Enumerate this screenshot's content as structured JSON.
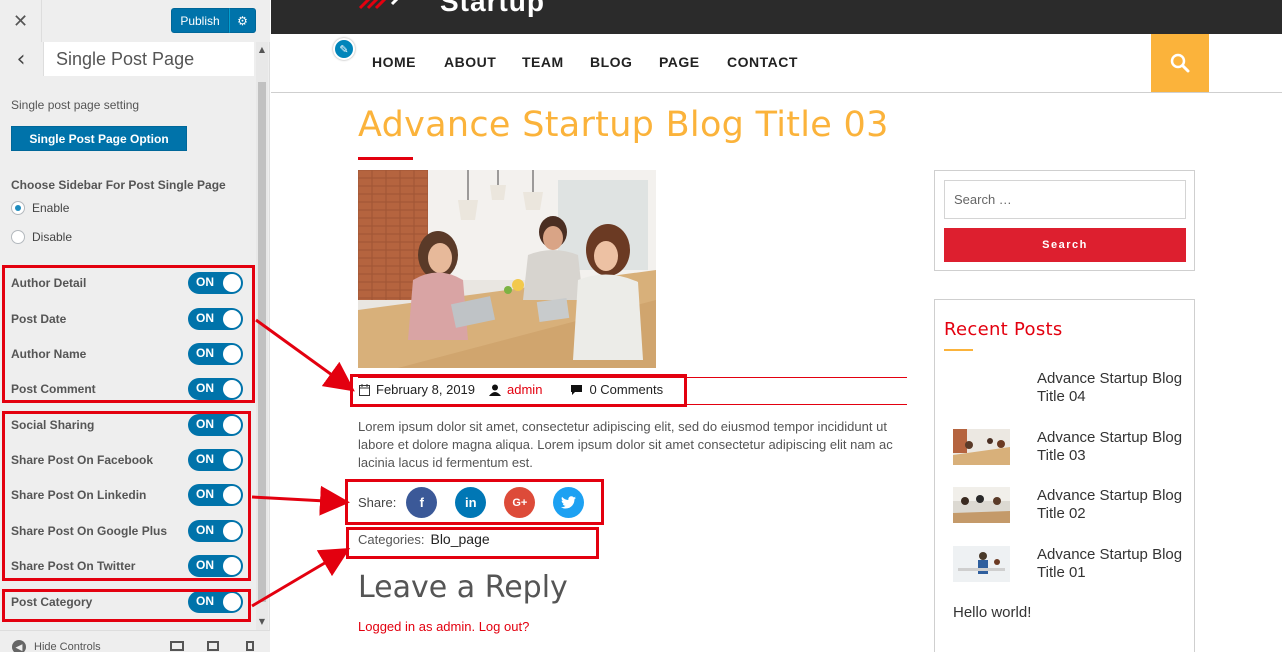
{
  "customizer": {
    "close_icon": "close-icon",
    "publish_label": "Publish",
    "section_title": "Single Post Page",
    "setting_caption": "Single post page setting",
    "option_button_label": "Single Post Page Option",
    "sidebar_group_label": "Choose Sidebar For Post Single Page",
    "radio_options": [
      {
        "label": "Enable",
        "checked": true
      },
      {
        "label": "Disable",
        "checked": false
      }
    ],
    "toggles": [
      {
        "label": "Author Detail",
        "state": "ON"
      },
      {
        "label": "Post Date",
        "state": "ON"
      },
      {
        "label": "Author Name",
        "state": "ON"
      },
      {
        "label": "Post Comment",
        "state": "ON"
      },
      {
        "label": "Social Sharing",
        "state": "ON"
      },
      {
        "label": "Share Post On Facebook",
        "state": "ON"
      },
      {
        "label": "Share Post On Linkedin",
        "state": "ON"
      },
      {
        "label": "Share Post On Google Plus",
        "state": "ON"
      },
      {
        "label": "Share Post On Twitter",
        "state": "ON"
      },
      {
        "label": "Post Category",
        "state": "ON"
      }
    ],
    "hide_controls_label": "Hide Controls",
    "accent_color": "#0073aa",
    "highlight_color": "#e3000f"
  },
  "site": {
    "logo_text": "Startup",
    "nav": [
      "HOME",
      "ABOUT",
      "TEAM",
      "BLOG",
      "PAGE",
      "CONTACT"
    ],
    "accent_color": "#fbb33b",
    "post": {
      "title": "Advance Startup Blog Title 03",
      "date": "February 8, 2019",
      "author": "admin",
      "comments": "0 Comments",
      "excerpt": "Lorem ipsum dolor sit amet, consectetur adipiscing elit, sed do eiusmod tempor incididunt ut labore et dolore magna aliqua. Lorem ipsum dolor sit amet consectetur adipiscing elit nam ac lacinia lacus id fermentum est.",
      "share_label": "Share:",
      "share_icons": [
        "facebook-icon",
        "linkedin-icon",
        "google-plus-icon",
        "twitter-icon"
      ],
      "categories_label": "Categories:",
      "category": "Blo_page"
    },
    "reply": {
      "title": "Leave a Reply",
      "logged_in": "Logged in as admin. Log out?"
    },
    "sidebar": {
      "search_placeholder": "Search …",
      "search_button": "Search",
      "recent_title": "Recent Posts",
      "recent_posts": [
        "Advance Startup Blog Title 04",
        "Advance Startup Blog Title 03",
        "Advance Startup Blog Title 02",
        "Advance Startup Blog Title 01"
      ],
      "hello_world": "Hello world!"
    }
  }
}
